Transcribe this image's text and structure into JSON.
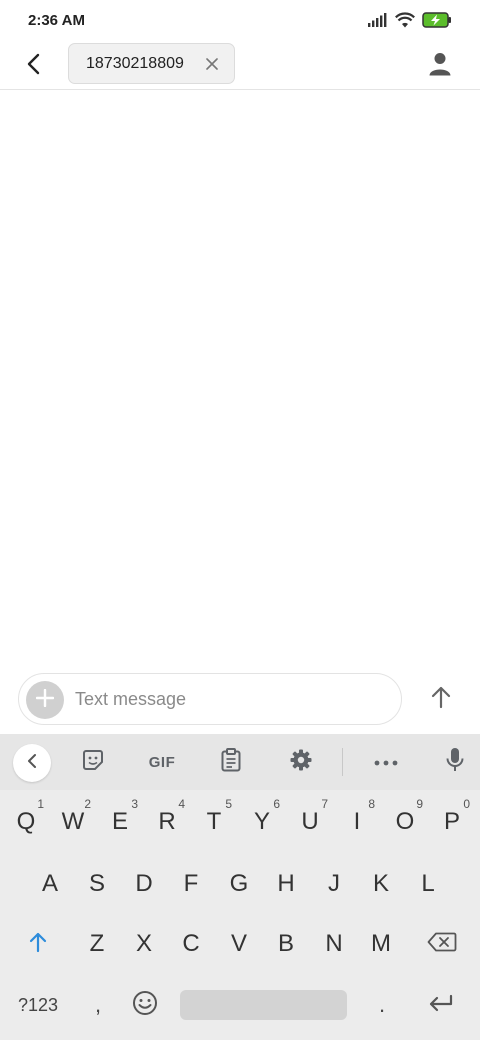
{
  "status_bar": {
    "time": "2:36 AM",
    "icons": [
      "signal-icon",
      "wifi-icon",
      "battery-charging-icon"
    ],
    "battery_color": "#5bbd2b"
  },
  "header": {
    "back_icon": "arrow-back-icon",
    "recipient": "18730218809",
    "remove_icon": "close-icon",
    "contact_icon": "person-icon"
  },
  "compose": {
    "add_icon": "plus-icon",
    "placeholder": "Text message",
    "value": "",
    "send_icon": "arrow-up-icon"
  },
  "keyboard": {
    "toolbar": {
      "collapse_icon": "chevron-left-icon",
      "sticker_icon": "sticker-icon",
      "gif_label": "GIF",
      "clipboard_icon": "clipboard-icon",
      "settings_icon": "gear-icon",
      "more_icon": "more-icon",
      "mic_icon": "microphone-icon"
    },
    "row1": [
      {
        "key": "Q",
        "num": "1"
      },
      {
        "key": "W",
        "num": "2"
      },
      {
        "key": "E",
        "num": "3"
      },
      {
        "key": "R",
        "num": "4"
      },
      {
        "key": "T",
        "num": "5"
      },
      {
        "key": "Y",
        "num": "6"
      },
      {
        "key": "U",
        "num": "7"
      },
      {
        "key": "I",
        "num": "8"
      },
      {
        "key": "O",
        "num": "9"
      },
      {
        "key": "P",
        "num": "0"
      }
    ],
    "row2": [
      "A",
      "S",
      "D",
      "F",
      "G",
      "H",
      "J",
      "K",
      "L"
    ],
    "row3": [
      "Z",
      "X",
      "C",
      "V",
      "B",
      "N",
      "M"
    ],
    "shift_icon": "shift-arrow-icon",
    "backspace_icon": "backspace-icon",
    "symbols_label": "?123",
    "comma_label": ",",
    "emoji_icon": "emoji-icon",
    "period_label": ".",
    "enter_icon": "enter-icon",
    "accent_color": "#2d8cdb"
  }
}
